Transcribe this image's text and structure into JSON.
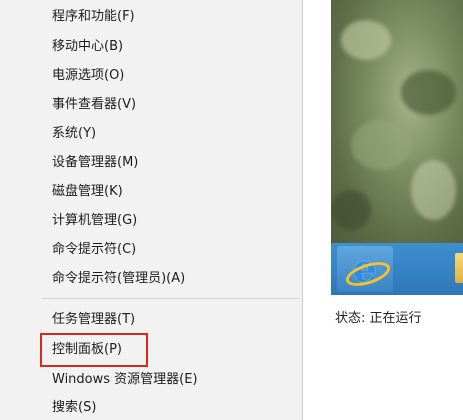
{
  "menu": {
    "items": [
      {
        "label": "程序和功能(F)"
      },
      {
        "label": "移动中心(B)"
      },
      {
        "label": "电源选项(O)"
      },
      {
        "label": "事件查看器(V)"
      },
      {
        "label": "系统(Y)"
      },
      {
        "label": "设备管理器(M)"
      },
      {
        "label": "磁盘管理(K)"
      },
      {
        "label": "计算机管理(G)"
      },
      {
        "label": "命令提示符(C)"
      },
      {
        "label": "命令提示符(管理员)(A)"
      },
      {
        "label": "任务管理器(T)"
      },
      {
        "label": "控制面板(P)"
      },
      {
        "label": "Windows 资源管理器(E)"
      },
      {
        "label": "搜索(S)"
      }
    ],
    "highlighted_item": "控制面板(P)",
    "highlight_color": "#e0251f"
  },
  "preview": {
    "status": "状态: 正在运行",
    "taskbar_icons": [
      "internet-explorer-icon",
      "folder-icon"
    ]
  }
}
